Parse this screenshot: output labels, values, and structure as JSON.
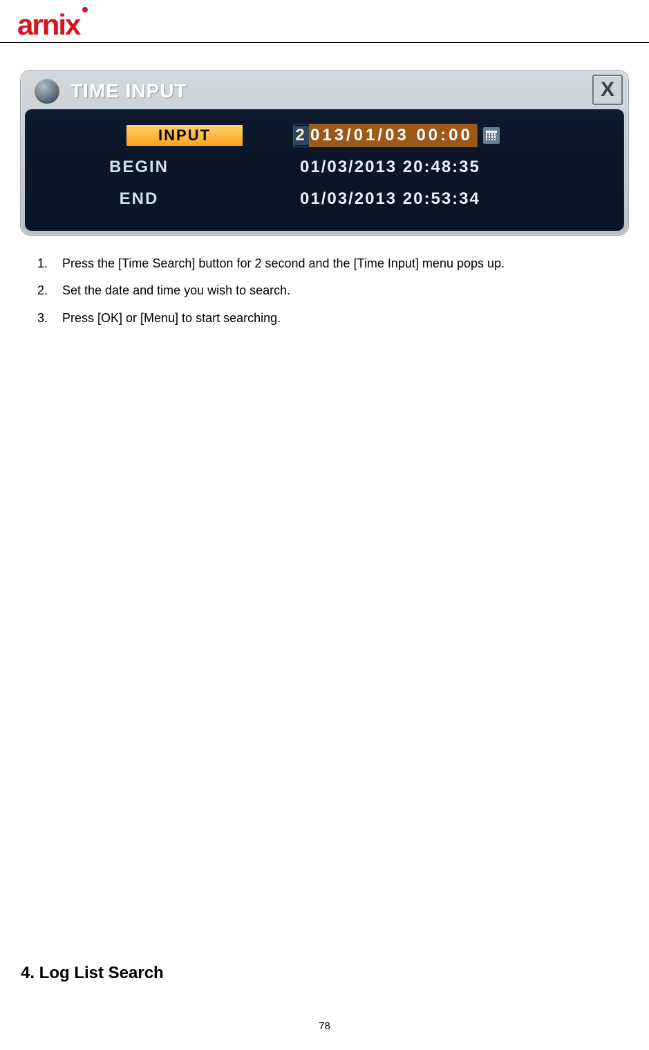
{
  "header": {
    "logo_text": "arnix"
  },
  "time_input_window": {
    "title": "TIME INPUT",
    "close_label": "X",
    "rows": {
      "input": {
        "label": "INPUT",
        "first_char": "2",
        "rest": "013/01/03 00:00"
      },
      "begin": {
        "label": "BEGIN",
        "value": "01/03/2013 20:48:35"
      },
      "end": {
        "label": "END",
        "value": "01/03/2013 20:53:34"
      }
    }
  },
  "instructions": [
    {
      "num": "1.",
      "text": "Press the [Time Search] button for 2 second and the [Time Input] menu pops up."
    },
    {
      "num": "2.",
      "text": "Set the date and time you wish to search."
    },
    {
      "num": "3.",
      "text": "Press [OK] or [Menu] to start searching."
    }
  ],
  "section_heading": "4. Log List Search",
  "page_number": "78"
}
